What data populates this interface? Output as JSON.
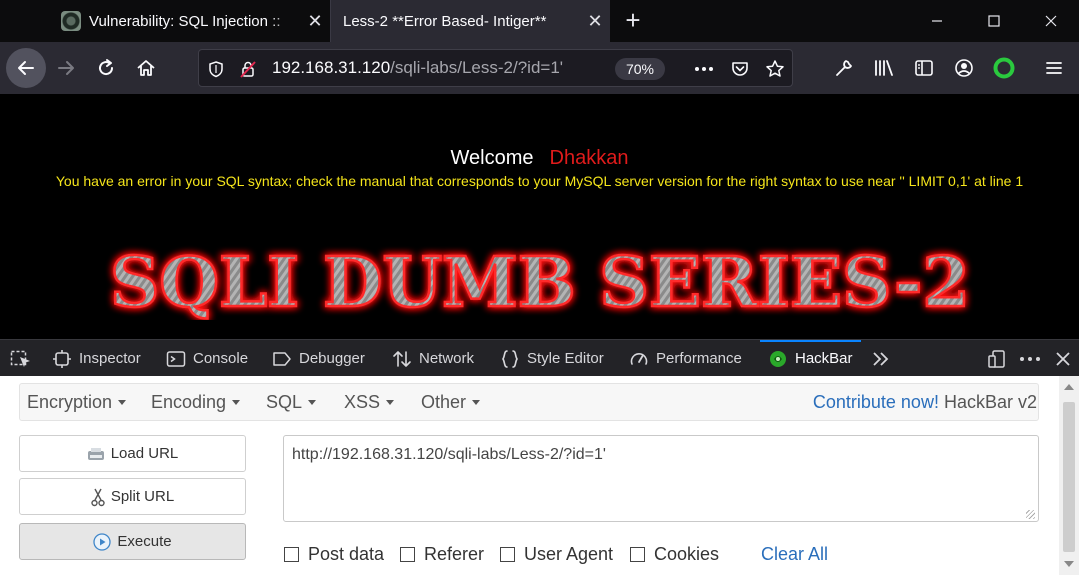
{
  "browser": {
    "tabs": [
      {
        "title": "Vulnerability: SQL Injection ::"
      },
      {
        "title": "Less-2 **Error Based- Intiger**"
      }
    ],
    "url_host": "192.168.31.120",
    "url_path": "/sqli-labs/Less-2/?id=1'",
    "zoom": "70%"
  },
  "page": {
    "welcome_label": "Welcome",
    "welcome_user": "Dhakkan",
    "sql_error": "You have an error in your SQL syntax; check the manual that corresponds to your MySQL server version for the right syntax to use near '' LIMIT 0,1' at line 1",
    "banner_text": "SQLI DUMB SERIES-2"
  },
  "devtools": {
    "tabs": [
      "Inspector",
      "Console",
      "Debugger",
      "Network",
      "Style Editor",
      "Performance",
      "HackBar"
    ],
    "active_tab": "HackBar"
  },
  "hackbar": {
    "menus": [
      "Encryption",
      "Encoding",
      "SQL",
      "XSS",
      "Other"
    ],
    "contribute_label": "Contribute now!",
    "version_label": "HackBar v2",
    "buttons": {
      "load_url": "Load URL",
      "split_url": "Split URL",
      "execute": "Execute"
    },
    "url_value": "http://192.168.31.120/sqli-labs/Less-2/?id=1'",
    "checkboxes": [
      "Post data",
      "Referer",
      "User Agent",
      "Cookies"
    ],
    "clear_all": "Clear All"
  },
  "colors": {
    "welcome_user": "#e01b1b",
    "sql_error": "#f5e51b",
    "link": "#2a6ebb",
    "active_tab_indicator": "#0a84ff"
  }
}
